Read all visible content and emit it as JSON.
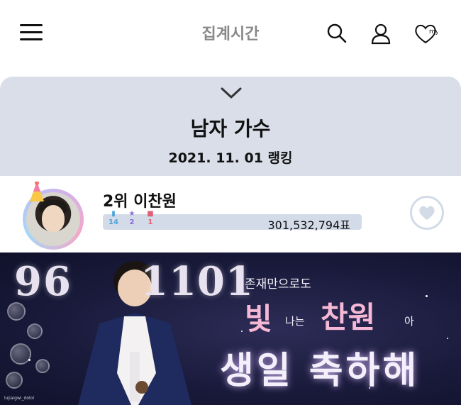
{
  "header": {
    "title": "집계시간",
    "icons": [
      "menu-icon",
      "search-icon",
      "user-icon",
      "heart-my-icon"
    ],
    "my_label": "my"
  },
  "ranking": {
    "category": "남자 가수",
    "date_label": "2021. 11. 01 랭킹",
    "panel_color": "#d9dee9"
  },
  "artist": {
    "rank_name": "2위 이찬원",
    "votes": "301,532,794표",
    "badges": [
      {
        "icon": "bookmark-icon",
        "count": "14",
        "color": "#4aa5d8"
      },
      {
        "icon": "star-icon",
        "count": "2",
        "color": "#8a6bd8"
      },
      {
        "icon": "gift-icon",
        "count": "1",
        "color": "#e0607a"
      }
    ],
    "vote_button_icon": "heart-icon"
  },
  "banner": {
    "num_left": "96",
    "num_right": "1101",
    "tagline": "존재만으로도",
    "word_bit": "빛",
    "word_naneun": "나는",
    "word_chanwon": "찬원",
    "word_a": "아",
    "birthday": "생일 축하해",
    "watermark": "lujiaigwi_dolol"
  }
}
